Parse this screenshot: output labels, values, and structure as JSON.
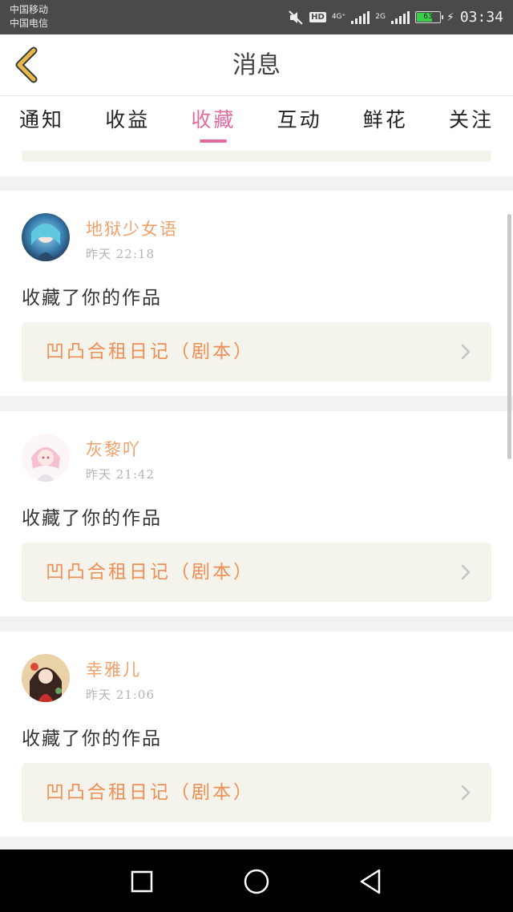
{
  "status_bar": {
    "carrier_1": "中国移动",
    "carrier_2": "中国电信",
    "hd": "HD",
    "net_1": "4G⁺",
    "net_2": "2G",
    "battery_level": "63",
    "time": "03:34"
  },
  "header": {
    "title": "消息",
    "back_icon": "chevron-left-icon"
  },
  "tabs": [
    {
      "label": "通知",
      "active": false
    },
    {
      "label": "收益",
      "active": false
    },
    {
      "label": "收藏",
      "active": true
    },
    {
      "label": "互动",
      "active": false
    },
    {
      "label": "鲜花",
      "active": false
    },
    {
      "label": "关注",
      "active": false
    }
  ],
  "messages": [
    {
      "username": "地狱少女语",
      "time": "昨天 22:18",
      "action": "收藏了你的作品",
      "work": "凹凸合租日记（剧本）"
    },
    {
      "username": "灰黎吖",
      "time": "昨天 21:42",
      "action": "收藏了你的作品",
      "work": "凹凸合租日记（剧本）"
    },
    {
      "username": "幸雅儿",
      "time": "昨天 21:06",
      "action": "收藏了你的作品",
      "work": "凹凸合租日记（剧本）"
    }
  ],
  "colors": {
    "accent": "#e06c9f",
    "username": "#f0a06a",
    "work_title": "#ee8f55",
    "work_box_bg": "#f4f3ec",
    "back_arrow": "#e8b84a"
  }
}
